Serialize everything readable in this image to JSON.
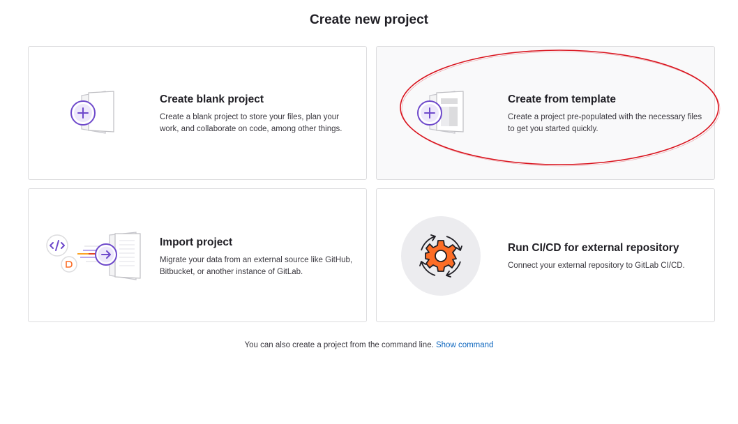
{
  "page": {
    "title": "Create new project"
  },
  "cards": [
    {
      "title": "Create blank project",
      "description": "Create a blank project to store your files, plan your work, and collaborate on code, among other things.",
      "icon": "blank-project-illustration"
    },
    {
      "title": "Create from template",
      "description": "Create a project pre-populated with the necessary files to get you started quickly.",
      "icon": "template-project-illustration"
    },
    {
      "title": "Import project",
      "description": "Migrate your data from an external source like GitHub, Bitbucket, or another instance of GitLab.",
      "icon": "import-project-illustration"
    },
    {
      "title": "Run CI/CD for external repository",
      "description": "Connect your external repository to GitLab CI/CD.",
      "icon": "cicd-gear-illustration"
    }
  ],
  "footer": {
    "text": "You can also create a project from the command line.",
    "link_label": "Show command"
  },
  "colors": {
    "accent_purple": "#6e49cb",
    "link_blue": "#1068bf",
    "annotation_red": "#d9121c",
    "gear_orange": "#fc6d26",
    "circle_bg": "#ececef"
  }
}
